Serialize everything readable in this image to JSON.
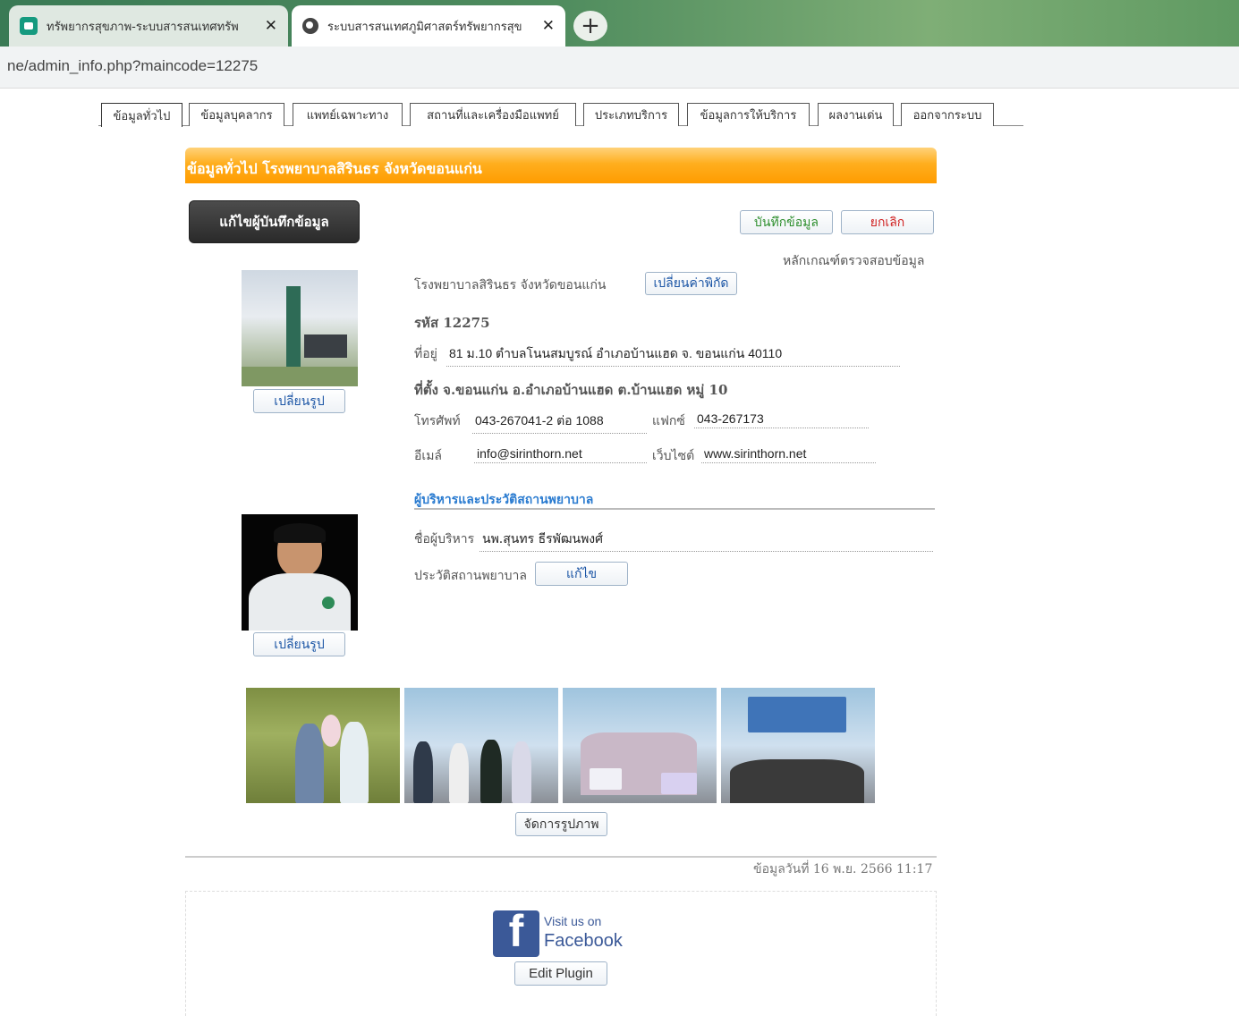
{
  "browser": {
    "tabs": [
      {
        "title": "ทรัพยากรสุขภาพ-ระบบสารสนเทศทรัพ",
        "active": false
      },
      {
        "title": "ระบบสารสนเทศภูมิศาสตร์ทรัพยากรสุข",
        "active": true
      }
    ],
    "url": "ne/admin_info.php?maincode=12275"
  },
  "nav": {
    "tabs": [
      "ข้อมูลทั่วไป",
      "ข้อมูลบุคลากร",
      "แพทย์เฉพาะทาง",
      "สถานที่และเครื่องมือแพทย์",
      "ประเภทบริการ",
      "ข้อมูลการให้บริการ",
      "ผลงานเด่น",
      "ออกจากระบบ"
    ]
  },
  "header": {
    "title": "ข้อมูลทั่วไป โรงพยาบาลสิรินธร จังหวัดขอนแก่น"
  },
  "actions": {
    "edit_recorder": "แก้ไขผู้บันทึกข้อมูล",
    "save": "บันทึกข้อมูล",
    "cancel": "ยกเลิก",
    "criteria_link": "หลักเกณฑ์ตรวจสอบข้อมูล",
    "change_photo": "เปลี่ยนรูป",
    "change_coords": "เปลี่ยนค่าพิกัด",
    "edit": "แก้ไข",
    "manage_photos": "จัดการรูปภาพ"
  },
  "hospital": {
    "name": "โรงพยาบาลสิรินธร จังหวัดขอนแก่น",
    "code": "รหัส 12275",
    "address_label": "ที่อยู่",
    "address": "81 ม.10 ตำบลโนนสมบูรณ์ อำเภอบ้านแฮด จ. ขอนแก่น 40110",
    "location": "ที่ตั้ง จ.ขอนแก่น อ.อำเภอบ้านแฮด ต.บ้านแฮด หมู่ 10",
    "phone_label": "โทรศัพท์",
    "phone": "043-267041-2 ต่อ 1088",
    "fax_label": "แฟกซ์",
    "fax": "043-267173",
    "email_label": "อีเมล์",
    "email": "info@sirinthorn.net",
    "website_label": "เว็บไซต์",
    "website": "www.sirinthorn.net"
  },
  "management": {
    "section_title": "ผู้บริหารและประวัติสถานพยาบาล",
    "director_label": "ชื่อผู้บริหาร",
    "director": "นพ.สุนทร ธีรพัฒนพงศ์",
    "history_label": "ประวัติสถานพยาบาล"
  },
  "footer": {
    "updated": "ข้อมูลวันที่ 16 พ.ย. 2566 11:17",
    "fb_visit": "Visit us on",
    "fb_name": "Facebook",
    "fb_logo_letter": "f",
    "edit_plugin": "Edit Plugin"
  }
}
